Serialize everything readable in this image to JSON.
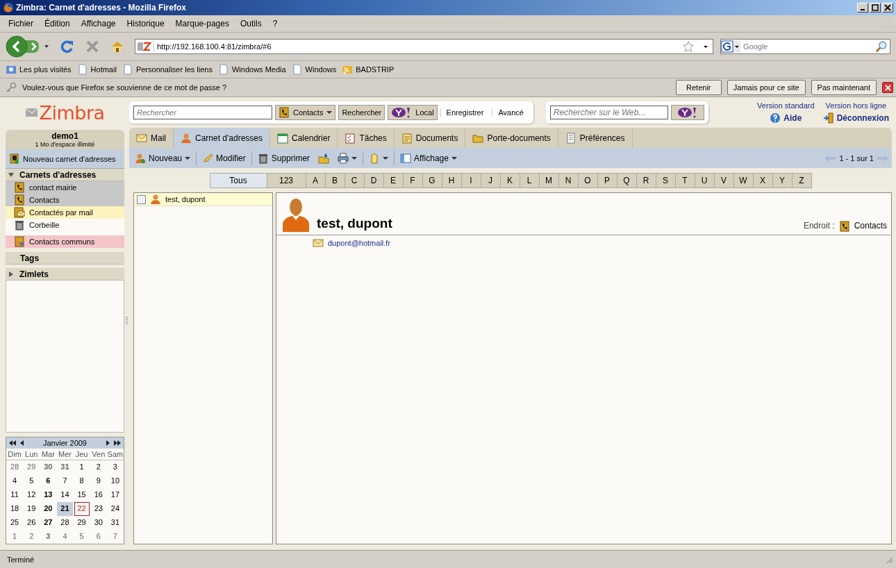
{
  "window": {
    "title": "Zimbra: Carnet d'adresses - Mozilla Firefox"
  },
  "menu": [
    "Fichier",
    "Édition",
    "Affichage",
    "Historique",
    "Marque-pages",
    "Outils",
    "?"
  ],
  "nav": {
    "url": "http://192.168.100.4:81/zimbra/#6",
    "search_placeholder": "Google"
  },
  "bookmarks": [
    {
      "label": "Les plus visités",
      "kind": "smart"
    },
    {
      "label": "Hotmail",
      "kind": "page"
    },
    {
      "label": "Personnaliser les liens",
      "kind": "page"
    },
    {
      "label": "Windows Media",
      "kind": "page"
    },
    {
      "label": "Windows",
      "kind": "page"
    },
    {
      "label": "BADSTRIP",
      "kind": "feed"
    }
  ],
  "password_bar": {
    "message": "Voulez-vous que Firefox se souvienne de ce mot de passe ?",
    "buttons": [
      "Retenir",
      "Jamais pour ce site",
      "Pas maintenant"
    ]
  },
  "header": {
    "logo": "Zimbra",
    "search_placeholder": "Rechercher",
    "search_type": "Contacts",
    "search_button": "Rechercher",
    "local_button": "Local",
    "save_button": "Enregistrer",
    "advanced_button": "Avancé",
    "web_placeholder": "Rechercher sur le Web...",
    "version_standard": "Version standard",
    "version_offline": "Version hors ligne",
    "help": "Aide",
    "logout": "Déconnexion"
  },
  "account": {
    "name": "demo1",
    "quota": "1 Mo d'espace illimité"
  },
  "sidebar": {
    "new_button": "Nouveau carnet d'adresses",
    "section": {
      "label": "Carnets d'adresses",
      "expanded": true
    },
    "items": [
      {
        "label": "contact mairie",
        "kind": "book",
        "color": "#c8c8c8"
      },
      {
        "label": "Contacts",
        "kind": "book",
        "color": "#c8c8c8"
      },
      {
        "label": "Contactés par mail",
        "kind": "mailbook",
        "color": "#fdf3bd"
      },
      {
        "label": "Corbeille",
        "kind": "trash",
        "color": "#fbfaf6"
      },
      {
        "label": "Contacts communs",
        "kind": "shared",
        "color": "#f4c4c8"
      }
    ],
    "tags": {
      "label": "Tags"
    },
    "zimlets": {
      "label": "Zimlets",
      "expanded": false
    }
  },
  "calendar": {
    "title": "Janvier 2009",
    "weekdays": [
      "Dim",
      "Lun",
      "Mar",
      "Mer",
      "Jeu",
      "Ven",
      "Sam"
    ],
    "weeks": [
      [
        {
          "day": "28",
          "other_month": true,
          "bold": false,
          "selected": false,
          "today": false
        },
        {
          "day": "29",
          "other_month": true,
          "bold": false,
          "selected": false,
          "today": false
        },
        {
          "day": "30",
          "other_month": true,
          "bold": true,
          "selected": false,
          "today": false
        },
        {
          "day": "31",
          "other_month": true,
          "bold": true,
          "selected": false,
          "today": false
        },
        {
          "day": "1",
          "other_month": false,
          "bold": false,
          "selected": false,
          "today": false
        },
        {
          "day": "2",
          "other_month": false,
          "bold": false,
          "selected": false,
          "today": false
        },
        {
          "day": "3",
          "other_month": false,
          "bold": false,
          "selected": false,
          "today": false
        }
      ],
      [
        {
          "day": "4",
          "other_month": false,
          "bold": false,
          "selected": false,
          "today": false
        },
        {
          "day": "5",
          "other_month": false,
          "bold": false,
          "selected": false,
          "today": false
        },
        {
          "day": "6",
          "other_month": false,
          "bold": true,
          "selected": false,
          "today": false
        },
        {
          "day": "7",
          "other_month": false,
          "bold": false,
          "selected": false,
          "today": false
        },
        {
          "day": "8",
          "other_month": false,
          "bold": false,
          "selected": false,
          "today": false
        },
        {
          "day": "9",
          "other_month": false,
          "bold": false,
          "selected": false,
          "today": false
        },
        {
          "day": "10",
          "other_month": false,
          "bold": false,
          "selected": false,
          "today": false
        }
      ],
      [
        {
          "day": "11",
          "other_month": false,
          "bold": false,
          "selected": false,
          "today": false
        },
        {
          "day": "12",
          "other_month": false,
          "bold": false,
          "selected": false,
          "today": false
        },
        {
          "day": "13",
          "other_month": false,
          "bold": true,
          "selected": false,
          "today": false
        },
        {
          "day": "14",
          "other_month": false,
          "bold": false,
          "selected": false,
          "today": false
        },
        {
          "day": "15",
          "other_month": false,
          "bold": false,
          "selected": false,
          "today": false
        },
        {
          "day": "16",
          "other_month": false,
          "bold": false,
          "selected": false,
          "today": false
        },
        {
          "day": "17",
          "other_month": false,
          "bold": false,
          "selected": false,
          "today": false
        }
      ],
      [
        {
          "day": "18",
          "other_month": false,
          "bold": false,
          "selected": false,
          "today": false
        },
        {
          "day": "19",
          "other_month": false,
          "bold": false,
          "selected": false,
          "today": false
        },
        {
          "day": "20",
          "other_month": false,
          "bold": true,
          "selected": false,
          "today": false
        },
        {
          "day": "21",
          "other_month": false,
          "bold": true,
          "selected": true,
          "today": false
        },
        {
          "day": "22",
          "other_month": false,
          "bold": false,
          "selected": false,
          "today": true
        },
        {
          "day": "23",
          "other_month": false,
          "bold": false,
          "selected": false,
          "today": false
        },
        {
          "day": "24",
          "other_month": false,
          "bold": false,
          "selected": false,
          "today": false
        }
      ],
      [
        {
          "day": "25",
          "other_month": false,
          "bold": false,
          "selected": false,
          "today": false
        },
        {
          "day": "26",
          "other_month": false,
          "bold": false,
          "selected": false,
          "today": false
        },
        {
          "day": "27",
          "other_month": false,
          "bold": true,
          "selected": false,
          "today": false
        },
        {
          "day": "28",
          "other_month": false,
          "bold": false,
          "selected": false,
          "today": false
        },
        {
          "day": "29",
          "other_month": false,
          "bold": false,
          "selected": false,
          "today": false
        },
        {
          "day": "30",
          "other_month": false,
          "bold": false,
          "selected": false,
          "today": false
        },
        {
          "day": "31",
          "other_month": false,
          "bold": false,
          "selected": false,
          "today": false
        }
      ],
      [
        {
          "day": "1",
          "other_month": true,
          "bold": false,
          "selected": false,
          "today": false
        },
        {
          "day": "2",
          "other_month": true,
          "bold": false,
          "selected": false,
          "today": false
        },
        {
          "day": "3",
          "other_month": true,
          "bold": true,
          "selected": false,
          "today": false
        },
        {
          "day": "4",
          "other_month": true,
          "bold": false,
          "selected": false,
          "today": false
        },
        {
          "day": "5",
          "other_month": true,
          "bold": false,
          "selected": false,
          "today": false
        },
        {
          "day": "6",
          "other_month": true,
          "bold": false,
          "selected": false,
          "today": false
        },
        {
          "day": "7",
          "other_month": true,
          "bold": false,
          "selected": false,
          "today": false
        }
      ]
    ]
  },
  "tabs": [
    {
      "label": "Mail",
      "kind": "mail",
      "selected": false
    },
    {
      "label": "Carnet d'adresses",
      "kind": "person",
      "selected": true
    },
    {
      "label": "Calendrier",
      "kind": "calendar",
      "selected": false
    },
    {
      "label": "Tâches",
      "kind": "tasks",
      "selected": false
    },
    {
      "label": "Documents",
      "kind": "notes",
      "selected": false
    },
    {
      "label": "Porte-documents",
      "kind": "folder",
      "selected": false
    },
    {
      "label": "Préférences",
      "kind": "prefs",
      "selected": false
    }
  ],
  "toolbar": {
    "new": "Nouveau",
    "edit": "Modifier",
    "delete": "Supprimer",
    "view": "Affichage",
    "pager": "1 - 1 sur 1"
  },
  "alphabet": [
    {
      "label": "Tous",
      "selected": true
    },
    {
      "label": "123",
      "selected": false
    },
    {
      "label": "A",
      "selected": false
    },
    {
      "label": "B",
      "selected": false
    },
    {
      "label": "C",
      "selected": false
    },
    {
      "label": "D",
      "selected": false
    },
    {
      "label": "E",
      "selected": false
    },
    {
      "label": "F",
      "selected": false
    },
    {
      "label": "G",
      "selected": false
    },
    {
      "label": "H",
      "selected": false
    },
    {
      "label": "I",
      "selected": false
    },
    {
      "label": "J",
      "selected": false
    },
    {
      "label": "K",
      "selected": false
    },
    {
      "label": "L",
      "selected": false
    },
    {
      "label": "M",
      "selected": false
    },
    {
      "label": "N",
      "selected": false
    },
    {
      "label": "O",
      "selected": false
    },
    {
      "label": "P",
      "selected": false
    },
    {
      "label": "Q",
      "selected": false
    },
    {
      "label": "R",
      "selected": false
    },
    {
      "label": "S",
      "selected": false
    },
    {
      "label": "T",
      "selected": false
    },
    {
      "label": "U",
      "selected": false
    },
    {
      "label": "V",
      "selected": false
    },
    {
      "label": "W",
      "selected": false
    },
    {
      "label": "X",
      "selected": false
    },
    {
      "label": "Y",
      "selected": false
    },
    {
      "label": "Z",
      "selected": false
    }
  ],
  "contacts": [
    {
      "name": "test, dupont",
      "checked": false,
      "selected": true
    }
  ],
  "detail": {
    "name": "test, dupont",
    "location_label": "Endroit :",
    "location": "Contacts",
    "email": "dupont@hotmail.fr"
  },
  "status_bar": {
    "text": "Terminé"
  }
}
